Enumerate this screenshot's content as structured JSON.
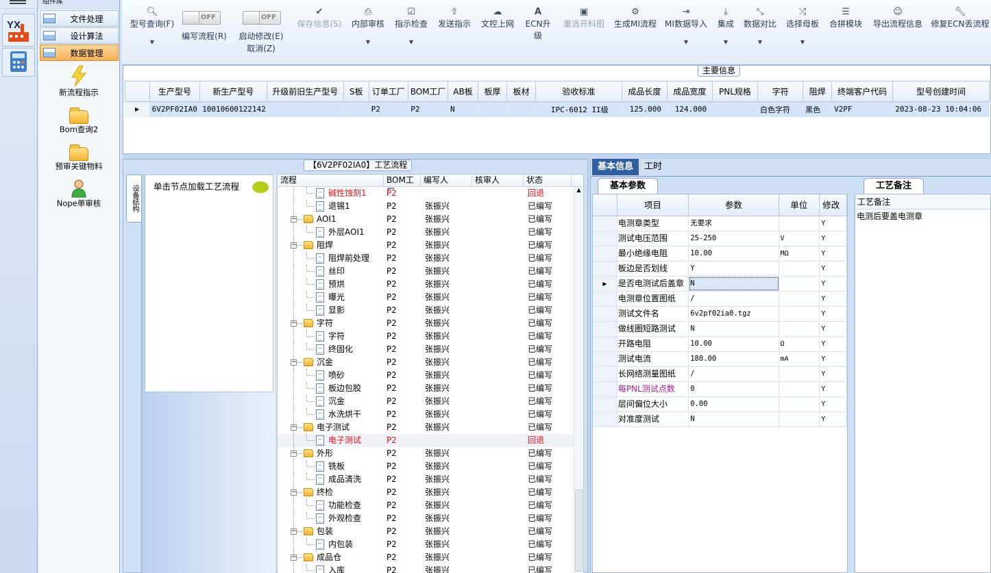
{
  "nav": {
    "header": "组件库",
    "items": [
      {
        "label": "文件处理"
      },
      {
        "label": "设计算法"
      },
      {
        "label": "数据管理"
      }
    ],
    "tools": [
      {
        "label": "新流程指示",
        "icon": "lightning-icon"
      },
      {
        "label": "Bom查询2",
        "icon": "folder-icon"
      },
      {
        "label": "预审关键物料",
        "icon": "folder-icon"
      },
      {
        "label": "Nope单审核",
        "icon": "user-icon"
      }
    ]
  },
  "toolbar": {
    "search": "型号查询(F)",
    "write_flow": "编写流程(R)",
    "toggle_off": "OFF",
    "start_modify": "启动修改(E)",
    "cancel": "取消(Z)",
    "save": "保存信息(S)",
    "internal_review": "内部审核",
    "check": "指示检查",
    "send": "发送指示",
    "upload": "文控上网",
    "ecn": "ECN升级",
    "reselect": "重选开料图",
    "gen_mi": "生成MI流程",
    "mi_import": "MI数据导入",
    "integrate": "集成",
    "compare": "数据对比",
    "select_master": "选择母板",
    "merge": "合拼模块",
    "export": "导出流程信息",
    "repair": "修复ECN丢流程"
  },
  "main": {
    "title": "主要信息",
    "columns": [
      "生产型号",
      "新生产型号",
      "升级前旧生产型号",
      "S板",
      "订单工厂",
      "BOM工厂",
      "AB板",
      "板厚",
      "板材",
      "验收标准",
      "成品长度",
      "成品宽度",
      "PNL规格",
      "字符",
      "阻焊",
      "终端客户代码",
      "型号创建时间"
    ],
    "row": [
      "6V2PF02IA0",
      "10010600122142",
      "",
      "",
      "P2",
      "P2",
      "N",
      "",
      "",
      "IPC-6012 II级",
      "125.000",
      "124.000",
      "",
      "白色字符",
      "黑色",
      "V2PF",
      "2023-08-23 10:04:06"
    ]
  },
  "flow": {
    "title": "【6V2PF02IA0】工艺流程",
    "vtab": "设备结构",
    "hint": "单击节点加载工艺流程",
    "columns": [
      "流程",
      "BOM工厂",
      "编写人",
      "核审人",
      "状态"
    ],
    "rows": [
      {
        "level": 1,
        "type": "doc",
        "name": "碱性蚀刻1",
        "bom": "P2",
        "writer": "",
        "reviewer": "",
        "status": "回退",
        "red": true
      },
      {
        "level": 1,
        "type": "doc",
        "name": "退锡1",
        "bom": "P2",
        "writer": "张振兴",
        "reviewer": "",
        "status": "已编写"
      },
      {
        "level": 0,
        "type": "folder",
        "name": "AOI1",
        "bom": "P2",
        "writer": "张振兴",
        "reviewer": "",
        "status": "已编写"
      },
      {
        "level": 1,
        "type": "doc",
        "name": "外层AOI1",
        "bom": "P2",
        "writer": "张振兴",
        "reviewer": "",
        "status": "已编写"
      },
      {
        "level": 0,
        "type": "folder",
        "name": "阻焊",
        "bom": "P2",
        "writer": "张振兴",
        "reviewer": "",
        "status": "已编写"
      },
      {
        "level": 1,
        "type": "doc",
        "name": "阻焊前处理",
        "bom": "P2",
        "writer": "张振兴",
        "reviewer": "",
        "status": "已编写"
      },
      {
        "level": 1,
        "type": "doc",
        "name": "丝印",
        "bom": "P2",
        "writer": "张振兴",
        "reviewer": "",
        "status": "已编写"
      },
      {
        "level": 1,
        "type": "doc",
        "name": "预烘",
        "bom": "P2",
        "writer": "张振兴",
        "reviewer": "",
        "status": "已编写"
      },
      {
        "level": 1,
        "type": "doc",
        "name": "曝光",
        "bom": "P2",
        "writer": "张振兴",
        "reviewer": "",
        "status": "已编写"
      },
      {
        "level": 1,
        "type": "doc",
        "name": "显影",
        "bom": "P2",
        "writer": "张振兴",
        "reviewer": "",
        "status": "已编写"
      },
      {
        "level": 0,
        "type": "folder",
        "name": "字符",
        "bom": "P2",
        "writer": "张振兴",
        "reviewer": "",
        "status": "已编写"
      },
      {
        "level": 1,
        "type": "doc",
        "name": "字符",
        "bom": "P2",
        "writer": "张振兴",
        "reviewer": "",
        "status": "已编写"
      },
      {
        "level": 1,
        "type": "doc",
        "name": "终固化",
        "bom": "P2",
        "writer": "张振兴",
        "reviewer": "",
        "status": "已编写"
      },
      {
        "level": 0,
        "type": "folder",
        "name": "沉金",
        "bom": "P2",
        "writer": "张振兴",
        "reviewer": "",
        "status": "已编写"
      },
      {
        "level": 1,
        "type": "doc",
        "name": "喷砂",
        "bom": "P2",
        "writer": "张振兴",
        "reviewer": "",
        "status": "已编写"
      },
      {
        "level": 1,
        "type": "doc",
        "name": "板边包胶",
        "bom": "P2",
        "writer": "张振兴",
        "reviewer": "",
        "status": "已编写"
      },
      {
        "level": 1,
        "type": "doc",
        "name": "沉金",
        "bom": "P2",
        "writer": "张振兴",
        "reviewer": "",
        "status": "已编写"
      },
      {
        "level": 1,
        "type": "doc",
        "name": "水洗烘干",
        "bom": "P2",
        "writer": "张振兴",
        "reviewer": "",
        "status": "已编写"
      },
      {
        "level": 0,
        "type": "folder",
        "name": "电子测试",
        "bom": "P2",
        "writer": "张振兴",
        "reviewer": "",
        "status": "已编写"
      },
      {
        "level": 1,
        "type": "doc",
        "name": "电子测试",
        "bom": "P2",
        "writer": "",
        "reviewer": "",
        "status": "回退",
        "red": true,
        "sel": true
      },
      {
        "level": 0,
        "type": "folder",
        "name": "外形",
        "bom": "P2",
        "writer": "张振兴",
        "reviewer": "",
        "status": "已编写"
      },
      {
        "level": 1,
        "type": "doc",
        "name": "铣板",
        "bom": "P2",
        "writer": "张振兴",
        "reviewer": "",
        "status": "已编写"
      },
      {
        "level": 1,
        "type": "doc",
        "name": "成品清洗",
        "bom": "P2",
        "writer": "张振兴",
        "reviewer": "",
        "status": "已编写"
      },
      {
        "level": 0,
        "type": "folder",
        "name": "终检",
        "bom": "P2",
        "writer": "张振兴",
        "reviewer": "",
        "status": "已编写"
      },
      {
        "level": 1,
        "type": "doc",
        "name": "功能检查",
        "bom": "P2",
        "writer": "张振兴",
        "reviewer": "",
        "status": "已编写"
      },
      {
        "level": 1,
        "type": "doc",
        "name": "外观检查",
        "bom": "P2",
        "writer": "张振兴",
        "reviewer": "",
        "status": "已编写"
      },
      {
        "level": 0,
        "type": "folder",
        "name": "包装",
        "bom": "P2",
        "writer": "张振兴",
        "reviewer": "",
        "status": "已编写"
      },
      {
        "level": 1,
        "type": "doc",
        "name": "内包装",
        "bom": "P2",
        "writer": "张振兴",
        "reviewer": "",
        "status": "已编写"
      },
      {
        "level": 0,
        "type": "folder",
        "name": "成品仓",
        "bom": "P2",
        "writer": "张振兴",
        "reviewer": "",
        "status": "已编写"
      },
      {
        "level": 1,
        "type": "doc",
        "name": "入库",
        "bom": "P2",
        "writer": "张振兴",
        "reviewer": "",
        "status": "已编写"
      }
    ]
  },
  "right": {
    "tabs": [
      "基本信息",
      "工时"
    ],
    "params_tab": "基本参数",
    "note_tab": "工艺备注",
    "param_columns": [
      "项目",
      "参数",
      "单位",
      "修改"
    ],
    "params": [
      {
        "item": "电测章类型",
        "value": "无要求",
        "unit": "",
        "mod": "Y"
      },
      {
        "item": "测试电压范围",
        "value": "25-250",
        "unit": "V",
        "mod": "Y"
      },
      {
        "item": "最小绝缘电阻",
        "value": "10.00",
        "unit": "MΩ",
        "mod": "Y"
      },
      {
        "item": "板边是否划线",
        "value": "Y",
        "unit": "",
        "mod": "Y"
      },
      {
        "item": "是否电测试后盖章",
        "value": "N",
        "unit": "",
        "mod": "Y",
        "current": true
      },
      {
        "item": "电测章位置图纸",
        "value": "/",
        "unit": "",
        "mod": "Y"
      },
      {
        "item": "测试文件名",
        "value": "6v2pf02ia0.tgz",
        "unit": "",
        "mod": "Y"
      },
      {
        "item": "做线圈短路测试",
        "value": "N",
        "unit": "",
        "mod": "Y"
      },
      {
        "item": "开路电阻",
        "value": "10.00",
        "unit": "Ω",
        "mod": "Y"
      },
      {
        "item": "测试电流",
        "value": "180.00",
        "unit": "mA",
        "mod": "Y"
      },
      {
        "item": "长网络测量图纸",
        "value": "/",
        "unit": "",
        "mod": "Y"
      },
      {
        "item": "每PNL测试点数",
        "value": "0",
        "unit": "",
        "mod": "Y",
        "purple": true
      },
      {
        "item": "层间偏位大小",
        "value": "0.00",
        "unit": "",
        "mod": "Y"
      },
      {
        "item": "对准度测试",
        "value": "N",
        "unit": "",
        "mod": "Y"
      }
    ],
    "note_header": "工艺备注",
    "note_text": "电测后要盖电测章"
  }
}
